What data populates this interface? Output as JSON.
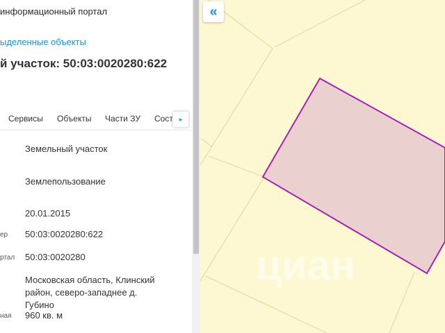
{
  "panel": {
    "portal_title": "информационный портал",
    "selected_objects_link": "ыделенные объекты",
    "parcel_title": "й участок: 50:03:0020280:622"
  },
  "tabs": {
    "items": [
      {
        "label": "Сервисы"
      },
      {
        "label": "Объекты"
      },
      {
        "label": "Части ЗУ"
      },
      {
        "label": "Соста"
      }
    ],
    "next_glyph": "▸"
  },
  "properties": [
    {
      "label": "",
      "value": "Земельный участок"
    },
    {
      "label": "",
      "value": "Землепользование"
    },
    {
      "label": "",
      "value": "20.01.2015"
    },
    {
      "label": "ер",
      "value": "50:03:0020280:622"
    },
    {
      "label": "ртал",
      "value": "50:03:0020280"
    },
    {
      "label": "",
      "value": "Московская область, Клинский район, северо-западнее д. Губино"
    },
    {
      "label": "ная",
      "value": "960 кв. м"
    }
  ],
  "map": {
    "collapse_glyph": "«",
    "watermark": "циан",
    "background_color": "#fdf8d2",
    "parcel_fill": "#ebd0d0",
    "parcel_stroke": "#a620b4",
    "boundary_color": "#e3dca0"
  }
}
